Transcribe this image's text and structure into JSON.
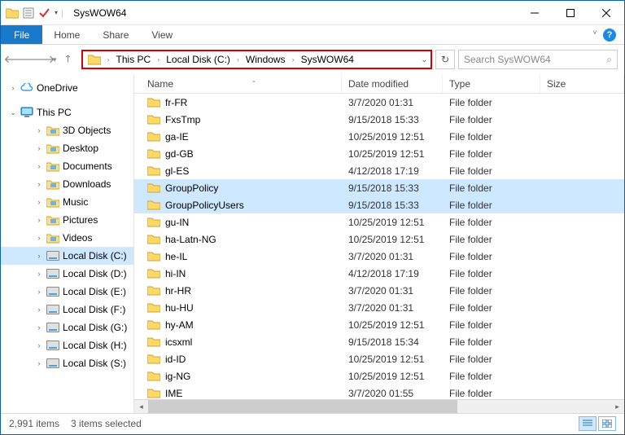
{
  "window": {
    "title": "SysWOW64"
  },
  "tabs": {
    "file": "File",
    "home": "Home",
    "share": "Share",
    "view": "View"
  },
  "breadcrumb": [
    "This PC",
    "Local Disk (C:)",
    "Windows",
    "SysWOW64"
  ],
  "search": {
    "placeholder": "Search SysWOW64"
  },
  "sidebar": {
    "onedrive": "OneDrive",
    "thispc": "This PC",
    "items": [
      {
        "label": "3D Objects"
      },
      {
        "label": "Desktop"
      },
      {
        "label": "Documents"
      },
      {
        "label": "Downloads"
      },
      {
        "label": "Music"
      },
      {
        "label": "Pictures"
      },
      {
        "label": "Videos"
      },
      {
        "label": "Local Disk (C:)",
        "selected": true
      },
      {
        "label": "Local Disk (D:)"
      },
      {
        "label": "Local Disk (E:)"
      },
      {
        "label": "Local Disk (F:)"
      },
      {
        "label": "Local Disk (G:)"
      },
      {
        "label": "Local Disk (H:)"
      },
      {
        "label": "Local Disk (S:)"
      }
    ]
  },
  "columns": {
    "name": "Name",
    "date": "Date modified",
    "type": "Type",
    "size": "Size"
  },
  "files": [
    {
      "name": "fr-FR",
      "date": "3/7/2020 01:31",
      "type": "File folder",
      "selected": false
    },
    {
      "name": "FxsTmp",
      "date": "9/15/2018 15:33",
      "type": "File folder",
      "selected": false
    },
    {
      "name": "ga-IE",
      "date": "10/25/2019 12:51",
      "type": "File folder",
      "selected": false
    },
    {
      "name": "gd-GB",
      "date": "10/25/2019 12:51",
      "type": "File folder",
      "selected": false
    },
    {
      "name": "gl-ES",
      "date": "4/12/2018 17:19",
      "type": "File folder",
      "selected": false
    },
    {
      "name": "GroupPolicy",
      "date": "9/15/2018 15:33",
      "type": "File folder",
      "selected": true
    },
    {
      "name": "GroupPolicyUsers",
      "date": "9/15/2018 15:33",
      "type": "File folder",
      "selected": true
    },
    {
      "name": "gu-IN",
      "date": "10/25/2019 12:51",
      "type": "File folder",
      "selected": false
    },
    {
      "name": "ha-Latn-NG",
      "date": "10/25/2019 12:51",
      "type": "File folder",
      "selected": false
    },
    {
      "name": "he-IL",
      "date": "3/7/2020 01:31",
      "type": "File folder",
      "selected": false
    },
    {
      "name": "hi-IN",
      "date": "4/12/2018 17:19",
      "type": "File folder",
      "selected": false
    },
    {
      "name": "hr-HR",
      "date": "3/7/2020 01:31",
      "type": "File folder",
      "selected": false
    },
    {
      "name": "hu-HU",
      "date": "3/7/2020 01:31",
      "type": "File folder",
      "selected": false
    },
    {
      "name": "hy-AM",
      "date": "10/25/2019 12:51",
      "type": "File folder",
      "selected": false
    },
    {
      "name": "icsxml",
      "date": "9/15/2018 15:34",
      "type": "File folder",
      "selected": false
    },
    {
      "name": "id-ID",
      "date": "10/25/2019 12:51",
      "type": "File folder",
      "selected": false
    },
    {
      "name": "ig-NG",
      "date": "10/25/2019 12:51",
      "type": "File folder",
      "selected": false
    },
    {
      "name": "IME",
      "date": "3/7/2020 01:55",
      "type": "File folder",
      "selected": false
    }
  ],
  "status": {
    "count": "2,991 items",
    "selection": "3 items selected"
  }
}
